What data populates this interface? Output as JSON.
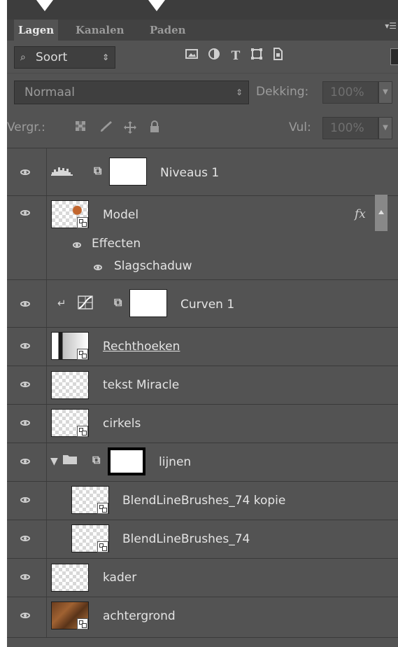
{
  "tabs": [
    {
      "label": "Lagen",
      "active": true
    },
    {
      "label": "Kanalen",
      "active": false
    },
    {
      "label": "Paden",
      "active": false
    }
  ],
  "filter": {
    "search_icon": "⌕",
    "value": "Soort",
    "arrows": "⇕"
  },
  "filter_icons": [
    "image-filter-icon",
    "adjustment-filter-icon",
    "type-filter-icon",
    "shape-filter-icon",
    "smart-object-filter-icon"
  ],
  "blend": {
    "mode": "Normaal",
    "opacity_label": "Dekking:",
    "opacity_value": "100%"
  },
  "lock": {
    "label": "Vergr.:",
    "fill_label": "Vul:",
    "fill_value": "100%"
  },
  "layers": [
    {
      "name": "Niveaus 1",
      "kind": "adjustment-levels"
    },
    {
      "name": "Model",
      "kind": "smart-object",
      "fx": "fx",
      "effects_label": "Effecten",
      "effect": "Slagschaduw"
    },
    {
      "name": "Curven 1",
      "kind": "adjustment-curves",
      "clipped": true
    },
    {
      "name": "Rechthoeken",
      "kind": "smart-object"
    },
    {
      "name": "tekst Miracle",
      "kind": "pixel"
    },
    {
      "name": "cirkels",
      "kind": "smart-object"
    },
    {
      "name": "lijnen",
      "kind": "group"
    },
    {
      "name": "BlendLineBrushes_74 kopie",
      "kind": "smart-object",
      "indent": true
    },
    {
      "name": "BlendLineBrushes_74",
      "kind": "smart-object",
      "indent": true
    },
    {
      "name": "kader",
      "kind": "pixel"
    },
    {
      "name": "achtergrond",
      "kind": "smart-object"
    }
  ],
  "colors": {
    "panel": "#535353",
    "tab_bar": "#424242",
    "text": "#e4e4e4",
    "separator": "#3a3a3a"
  }
}
